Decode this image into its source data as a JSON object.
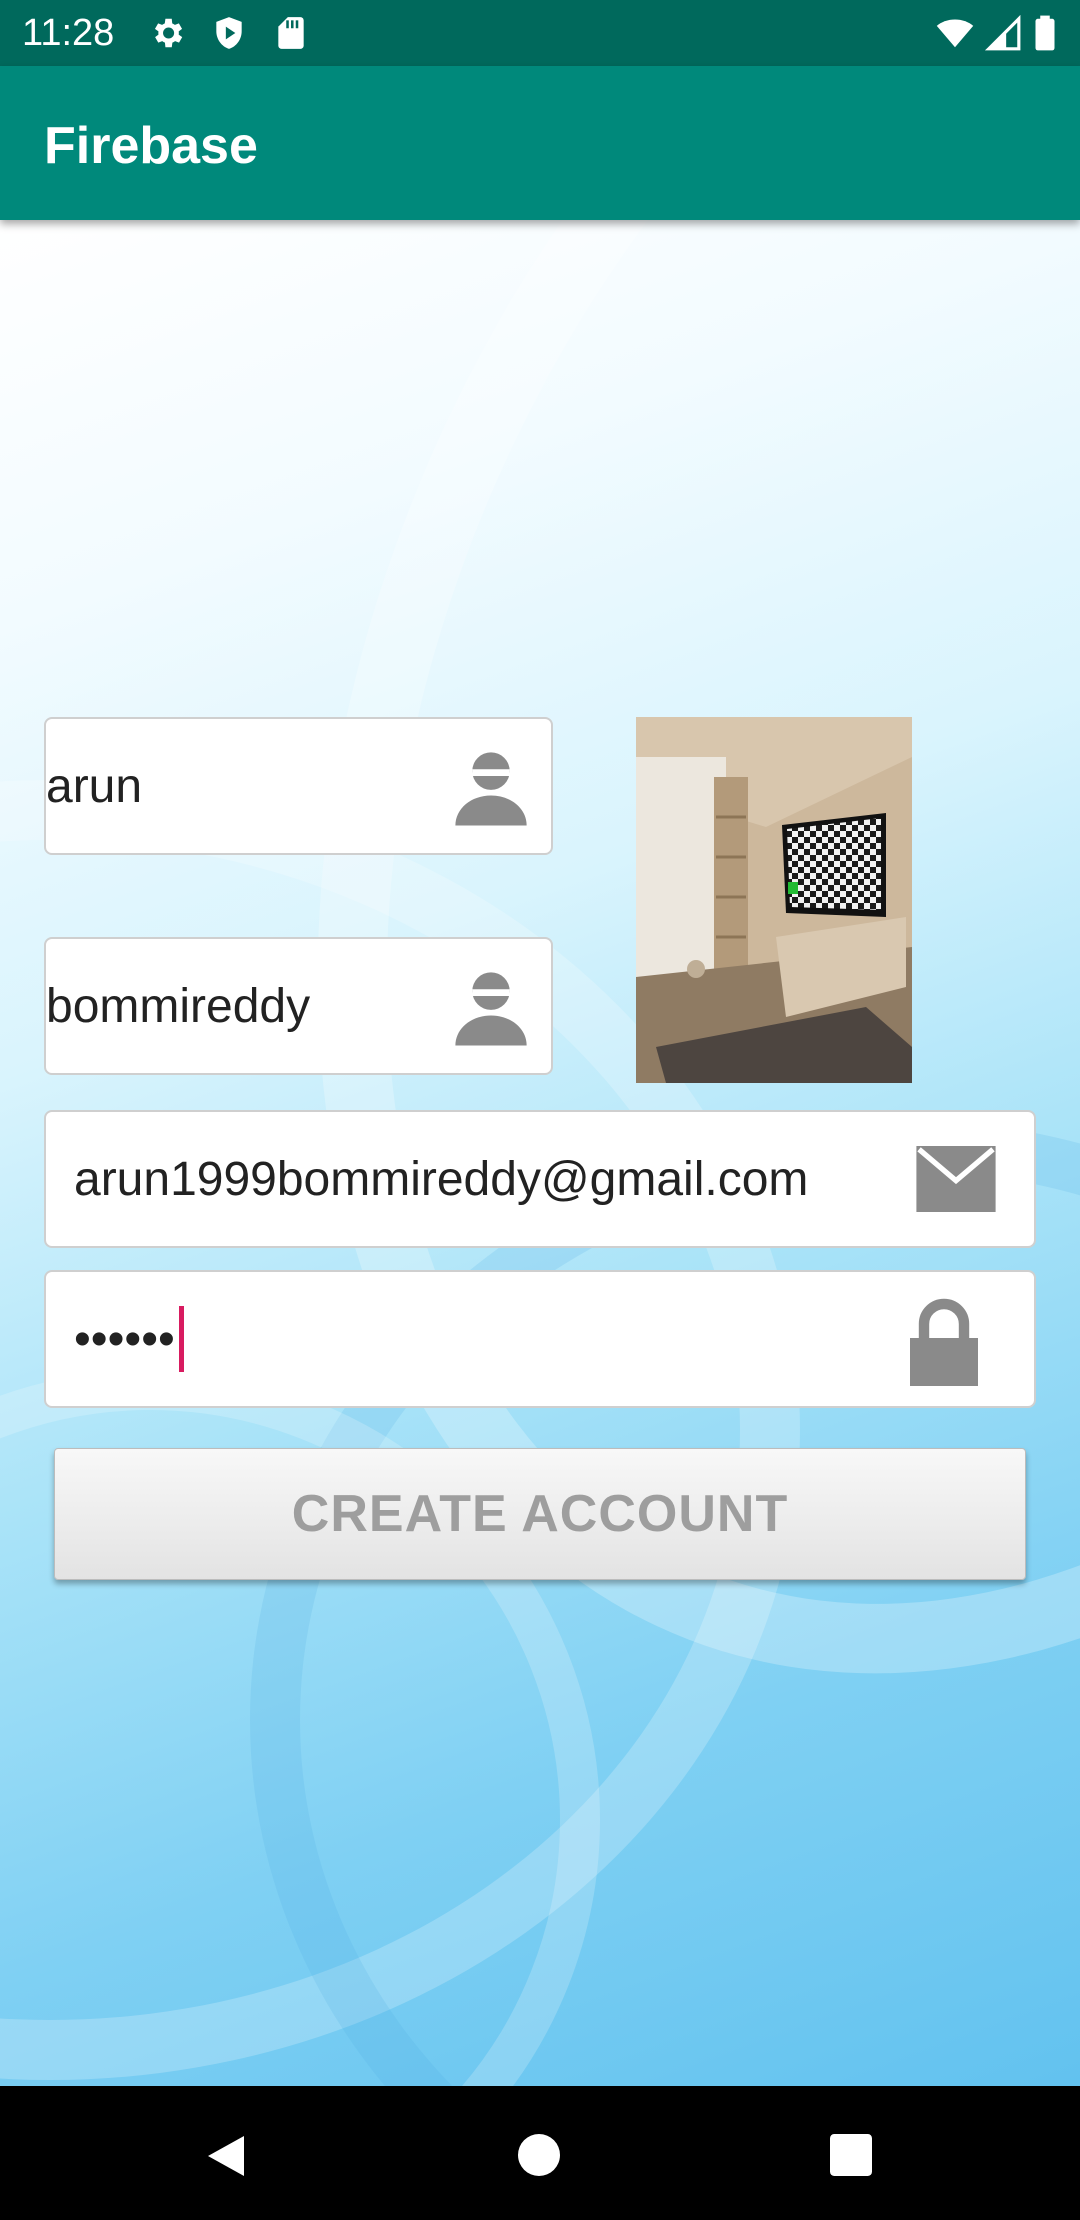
{
  "status_bar": {
    "time": "11:28",
    "left_icons": [
      "gear-icon",
      "shield-play-icon",
      "sd-card-icon"
    ],
    "right_icons": [
      "wifi-icon",
      "cellular-icon",
      "battery-icon"
    ]
  },
  "app_bar": {
    "title": "Firebase"
  },
  "form": {
    "first_name": {
      "value": "arun",
      "icon": "person-icon"
    },
    "last_name": {
      "value": "bommireddy",
      "icon": "person-icon"
    },
    "email": {
      "value": "arun1999bommireddy@gmail.com",
      "icon": "mail-icon"
    },
    "password": {
      "value": "••••••",
      "icon": "lock-icon"
    },
    "photo": {
      "icon": "profile-photo"
    },
    "create_account_label": "CREATE ACCOUNT"
  },
  "nav_bar": {
    "buttons": [
      "back",
      "home",
      "recents"
    ]
  },
  "colors": {
    "status_bar": "#00695c",
    "app_bar": "#00897b",
    "cursor": "#d81b60",
    "icon_gray": "#8a8a8a"
  }
}
